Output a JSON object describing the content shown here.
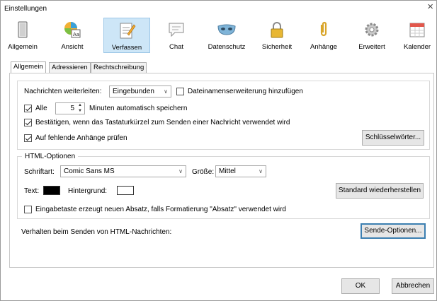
{
  "window": {
    "title": "Einstellungen",
    "close": "×"
  },
  "toolbar": {
    "items": [
      {
        "label": "Allgemein",
        "icon": "switch-icon"
      },
      {
        "label": "Ansicht",
        "icon": "palette-icon"
      },
      {
        "label": "Verfassen",
        "icon": "compose-icon",
        "active": true
      },
      {
        "label": "Chat",
        "icon": "chat-bubble-icon"
      },
      {
        "label": "Datenschutz",
        "icon": "mask-icon"
      },
      {
        "label": "Sicherheit",
        "icon": "padlock-icon"
      },
      {
        "label": "Anhänge",
        "icon": "paperclip-icon"
      },
      {
        "label": "Erweitert",
        "icon": "gear-icon"
      },
      {
        "label": "Kalender",
        "icon": "calendar-icon"
      }
    ]
  },
  "tabs": [
    "Allgemein",
    "Adressieren",
    "Rechtschreibung"
  ],
  "general": {
    "forward_label": "Nachrichten weiterleiten:",
    "forward_value": "Eingebunden",
    "ext_label": "Dateinamenserweiterung hinzufügen",
    "autosave_label": "Alle",
    "autosave_value": "5",
    "autosave_suffix": "Minuten automatisch speichern",
    "confirm_label": "Bestätigen, wenn das Tastaturkürzel zum Senden einer Nachricht verwendet wird",
    "attach_label": "Auf fehlende Anhänge prüfen",
    "keywords_button": "Schlüsselwörter..."
  },
  "html": {
    "section_title": "HTML-Optionen",
    "font_label": "Schriftart:",
    "font_value": "Comic Sans MS",
    "size_label": "Größe:",
    "size_value": "Mittel",
    "text_label": "Text:",
    "bg_label": "Hintergrund:",
    "restore_button": "Standard wiederherstellen",
    "enter_label": "Eingabetaste erzeugt neuen Absatz, falls Formatierung \"Absatz\" verwendet wird",
    "text_color": "#000000",
    "bg_color": "#ffffff"
  },
  "send": {
    "label": "Verhalten beim Senden von HTML-Nachrichten:",
    "button": "Sende-Optionen..."
  },
  "footer": {
    "ok": "OK",
    "cancel": "Abbrechen"
  },
  "colors": {
    "active_tab_bg": "#cde6f7",
    "accent": "#3c7fb1"
  }
}
